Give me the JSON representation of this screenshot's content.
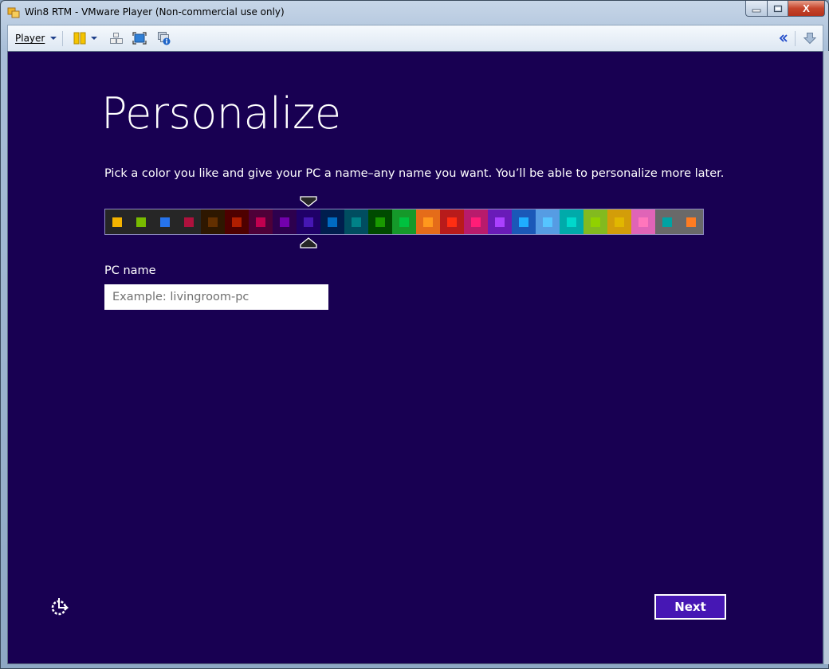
{
  "window": {
    "title": "Win8 RTM - VMware Player (Non-commercial use only)",
    "controls": {
      "minimize": "—",
      "maximize": "□",
      "close": "X"
    }
  },
  "toolbar": {
    "player_label": "Player",
    "icons": [
      "pause-icon",
      "send-ctrl-alt-del-icon",
      "fullscreen-icon",
      "unity-icon",
      "collapse-toolbar-icon",
      "download-icon"
    ]
  },
  "setup": {
    "heading": "Personalize",
    "description": "Pick a color you like and give your PC a name–any name you want. You’ll be able to personalize more later.",
    "selected_color_index": 8,
    "palette": [
      {
        "bg": "#262626",
        "swatches": [
          "#f4b300",
          "#78ba00",
          "#2673ec",
          "#ae113d"
        ]
      },
      {
        "bg": "#2e1700",
        "swatches": [
          "#632f00"
        ]
      },
      {
        "bg": "#4e0000",
        "swatches": [
          "#b01e00"
        ]
      },
      {
        "bg": "#4e0038",
        "swatches": [
          "#c1004f"
        ]
      },
      {
        "bg": "#2d004e",
        "swatches": [
          "#7200ac"
        ]
      },
      {
        "bg": "#1f0068",
        "swatches": [
          "#4617b4"
        ]
      },
      {
        "bg": "#001e4e",
        "swatches": [
          "#006ac1"
        ]
      },
      {
        "bg": "#004d60",
        "swatches": [
          "#008287"
        ]
      },
      {
        "bg": "#004a00",
        "swatches": [
          "#199900"
        ]
      },
      {
        "bg": "#15992a",
        "swatches": [
          "#00c13f"
        ]
      },
      {
        "bg": "#e56c19",
        "swatches": [
          "#ff981d"
        ]
      },
      {
        "bg": "#b81b1b",
        "swatches": [
          "#ff2e12"
        ]
      },
      {
        "bg": "#b81b6c",
        "swatches": [
          "#ff1d77"
        ]
      },
      {
        "bg": "#691bb8",
        "swatches": [
          "#aa40ff"
        ]
      },
      {
        "bg": "#1b58b8",
        "swatches": [
          "#1faeff"
        ]
      },
      {
        "bg": "#569ce3",
        "swatches": [
          "#56c5ff"
        ]
      },
      {
        "bg": "#00aaaa",
        "swatches": [
          "#00d8cc"
        ]
      },
      {
        "bg": "#83ba1f",
        "swatches": [
          "#91d100"
        ]
      },
      {
        "bg": "#d39d09",
        "swatches": [
          "#e1b700"
        ]
      },
      {
        "bg": "#e064b7",
        "swatches": [
          "#ff76bc"
        ]
      },
      {
        "bg": "#696969",
        "swatches": [
          "#00a3a3",
          "#fe7c22"
        ]
      }
    ],
    "pc_name_label": "PC name",
    "pc_name_value": "",
    "pc_name_placeholder": "Example: livingroom-pc",
    "next_label": "Next",
    "ease_of_access_icon": "ease-of-access-icon"
  }
}
